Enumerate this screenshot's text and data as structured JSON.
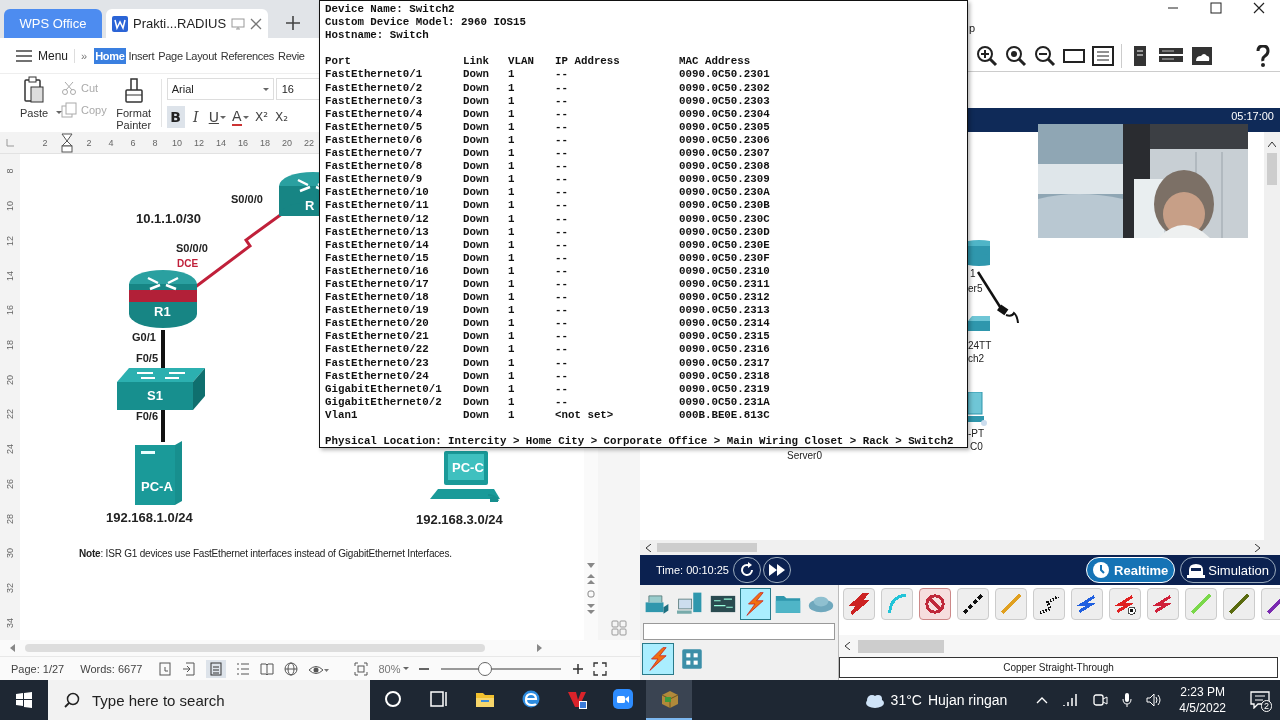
{
  "word_window": {
    "tabs": [
      {
        "label": "WPS Office",
        "kind": "home",
        "selected": false
      },
      {
        "label": "Prakti...RADIUS",
        "kind": "document",
        "selected": true
      }
    ],
    "menu_button": "Menu",
    "more": "»",
    "ribbon_tabs": [
      {
        "label": "Home",
        "selected": true
      },
      {
        "label": "Insert",
        "selected": false
      },
      {
        "label": "Page Layout",
        "selected": false
      },
      {
        "label": "References",
        "selected": false
      },
      {
        "label": "Revie",
        "selected": false
      }
    ],
    "clipboard": [
      {
        "label": "Paste",
        "kind": "large",
        "disabled": false
      },
      {
        "label": "Cut",
        "kind": "small",
        "disabled": true
      },
      {
        "label": "Copy",
        "kind": "small",
        "disabled": true
      },
      {
        "label": "Format Painter",
        "kind": "large",
        "disabled": false
      }
    ],
    "font": {
      "name": "Arial",
      "size": "16"
    },
    "format_buttons": [
      {
        "label": "B",
        "kind": "bold",
        "selected": true
      },
      {
        "label": "I",
        "kind": "italic",
        "selected": false
      },
      {
        "label": "U",
        "kind": "underline",
        "selected": false
      },
      {
        "label": "A",
        "kind": "font_color",
        "selected": false
      },
      {
        "label": "X²",
        "kind": "superscript",
        "selected": false
      },
      {
        "label": "X₂",
        "kind": "subscript",
        "selected": false
      }
    ],
    "ruler_numbers": [
      "2",
      "2",
      "4",
      "6",
      "8",
      "10",
      "12",
      "14",
      "16",
      "18",
      "20",
      "22"
    ],
    "side_ruler_numbers": [
      "8",
      "10",
      "12",
      "14",
      "16",
      "18",
      "20",
      "22",
      "24",
      "26",
      "28",
      "30",
      "32",
      "34"
    ],
    "diagram": {
      "links": [
        {
          "kind": "serial"
        },
        {
          "kind": "ethernet"
        },
        {
          "kind": "ethernet"
        }
      ],
      "devices": [
        {
          "label": "R",
          "kind": "router"
        },
        {
          "label": "R1",
          "kind": "secure_router"
        },
        {
          "label": "S1",
          "kind": "switch"
        },
        {
          "label": "PC-A",
          "kind": "tower"
        },
        {
          "label": "PC-C",
          "kind": "desktop"
        }
      ],
      "labels": [
        {
          "text": "S0/0/0",
          "kind": "interface"
        },
        {
          "text": "10.1.1.0/30",
          "kind": "network"
        },
        {
          "text": "S0/0/0",
          "kind": "interface"
        },
        {
          "text": "DCE",
          "kind": "dce"
        },
        {
          "text": "G0/1",
          "kind": "interface"
        },
        {
          "text": "F0/5",
          "kind": "interface"
        },
        {
          "text": "F0/6",
          "kind": "interface"
        },
        {
          "text": "192.168.1.0/24",
          "kind": "network"
        },
        {
          "text": "192.168.3.0/24",
          "kind": "network"
        }
      ],
      "note": "**Note**: ISR G1 devices use FastEthernet interfaces instead of GigabitEthernet Interfaces."
    },
    "status": {
      "page": "Page: 1/27",
      "words": "Words: 6677",
      "zoom": "80%",
      "level": 0.36
    }
  },
  "tracer_window": {
    "menu_fragment": "p",
    "clock": "05:17:00",
    "workspace_labels": [
      "1",
      "er5",
      "24TT",
      "ch2",
      "-PT",
      "C0",
      "Server0"
    ],
    "time": "Time: 00:10:25",
    "modes": [
      {
        "label": "Realtime",
        "selected": true
      },
      {
        "label": "Simulation",
        "selected": false
      }
    ],
    "device_categories": [
      {
        "kind": "network",
        "selected": false
      },
      {
        "kind": "end_devices",
        "selected": false
      },
      {
        "kind": "components",
        "selected": false
      },
      {
        "kind": "connections",
        "selected": true
      },
      {
        "kind": "misc",
        "selected": false
      },
      {
        "kind": "multiuser",
        "selected": false
      }
    ],
    "sub_categories": [
      {
        "kind": "connections",
        "selected": true
      },
      {
        "kind": "grid",
        "selected": false
      }
    ],
    "cables": [
      {
        "kind": "bolt",
        "selected": false
      },
      {
        "kind": "curve",
        "color": "#22c4d8",
        "selected": false
      },
      {
        "kind": "blocked",
        "selected": true
      },
      {
        "kind": "dashed",
        "color": "#111111",
        "selected": false
      },
      {
        "kind": "line",
        "color": "#e0a020",
        "selected": false
      },
      {
        "kind": "dotted",
        "color": "#111111",
        "selected": false
      },
      {
        "kind": "zigzag",
        "color": "#1f5fe0",
        "selected": false
      },
      {
        "kind": "zigzag_clock",
        "color": "#e02020",
        "selected": false
      },
      {
        "kind": "zigzag",
        "color": "#d0203a",
        "selected": false
      },
      {
        "kind": "line",
        "color": "#7ad84a",
        "selected": false
      },
      {
        "kind": "line",
        "color": "#5a6b10",
        "selected": false
      },
      {
        "kind": "line",
        "color": "#7a2ab0",
        "selected": false
      }
    ],
    "cable_name": "Copper Straight-Through"
  },
  "tooltip": {
    "lines": [
      "Device Name: Switch2",
      "Custom Device Model: 2960 IOS15",
      "Hostname: Switch"
    ],
    "columns": [
      "Port",
      "Link",
      "VLAN",
      "IP Address",
      "MAC Address"
    ],
    "rows": [
      [
        "FastEthernet0/1",
        "Down",
        "1",
        "--",
        "0090.0C50.2301"
      ],
      [
        "FastEthernet0/2",
        "Down",
        "1",
        "--",
        "0090.0C50.2302"
      ],
      [
        "FastEthernet0/3",
        "Down",
        "1",
        "--",
        "0090.0C50.2303"
      ],
      [
        "FastEthernet0/4",
        "Down",
        "1",
        "--",
        "0090.0C50.2304"
      ],
      [
        "FastEthernet0/5",
        "Down",
        "1",
        "--",
        "0090.0C50.2305"
      ],
      [
        "FastEthernet0/6",
        "Down",
        "1",
        "--",
        "0090.0C50.2306"
      ],
      [
        "FastEthernet0/7",
        "Down",
        "1",
        "--",
        "0090.0C50.2307"
      ],
      [
        "FastEthernet0/8",
        "Down",
        "1",
        "--",
        "0090.0C50.2308"
      ],
      [
        "FastEthernet0/9",
        "Down",
        "1",
        "--",
        "0090.0C50.2309"
      ],
      [
        "FastEthernet0/10",
        "Down",
        "1",
        "--",
        "0090.0C50.230A"
      ],
      [
        "FastEthernet0/11",
        "Down",
        "1",
        "--",
        "0090.0C50.230B"
      ],
      [
        "FastEthernet0/12",
        "Down",
        "1",
        "--",
        "0090.0C50.230C"
      ],
      [
        "FastEthernet0/13",
        "Down",
        "1",
        "--",
        "0090.0C50.230D"
      ],
      [
        "FastEthernet0/14",
        "Down",
        "1",
        "--",
        "0090.0C50.230E"
      ],
      [
        "FastEthernet0/15",
        "Down",
        "1",
        "--",
        "0090.0C50.230F"
      ],
      [
        "FastEthernet0/16",
        "Down",
        "1",
        "--",
        "0090.0C50.2310"
      ],
      [
        "FastEthernet0/17",
        "Down",
        "1",
        "--",
        "0090.0C50.2311"
      ],
      [
        "FastEthernet0/18",
        "Down",
        "1",
        "--",
        "0090.0C50.2312"
      ],
      [
        "FastEthernet0/19",
        "Down",
        "1",
        "--",
        "0090.0C50.2313"
      ],
      [
        "FastEthernet0/20",
        "Down",
        "1",
        "--",
        "0090.0C50.2314"
      ],
      [
        "FastEthernet0/21",
        "Down",
        "1",
        "--",
        "0090.0C50.2315"
      ],
      [
        "FastEthernet0/22",
        "Down",
        "1",
        "--",
        "0090.0C50.2316"
      ],
      [
        "FastEthernet0/23",
        "Down",
        "1",
        "--",
        "0090.0C50.2317"
      ],
      [
        "FastEthernet0/24",
        "Down",
        "1",
        "--",
        "0090.0C50.2318"
      ],
      [
        "GigabitEthernet0/1",
        "Down",
        "1",
        "--",
        "0090.0C50.2319"
      ],
      [
        "GigabitEthernet0/2",
        "Down",
        "1",
        "--",
        "0090.0C50.231A"
      ],
      [
        "Vlan1",
        "Down",
        "1",
        "<not set>",
        "000B.BE0E.813C"
      ]
    ],
    "location": "Physical Location: Intercity > Home City > Corporate Office > Main Wiring Closet > Rack > Switch2"
  },
  "taskbar": {
    "search_placeholder": "Type here to search",
    "apps": [
      {
        "kind": "cortana",
        "selected": false
      },
      {
        "kind": "task_view",
        "selected": false
      },
      {
        "kind": "explorer",
        "selected": false
      },
      {
        "kind": "edge",
        "selected": false
      },
      {
        "kind": "wps",
        "selected": false
      },
      {
        "kind": "zoom",
        "selected": false
      },
      {
        "kind": "packet_tracer",
        "selected": true
      }
    ],
    "temperature": "31°C",
    "weather": "Hujan ringan",
    "time": "2:23 PM",
    "date": "4/5/2022",
    "notifications": "2"
  }
}
